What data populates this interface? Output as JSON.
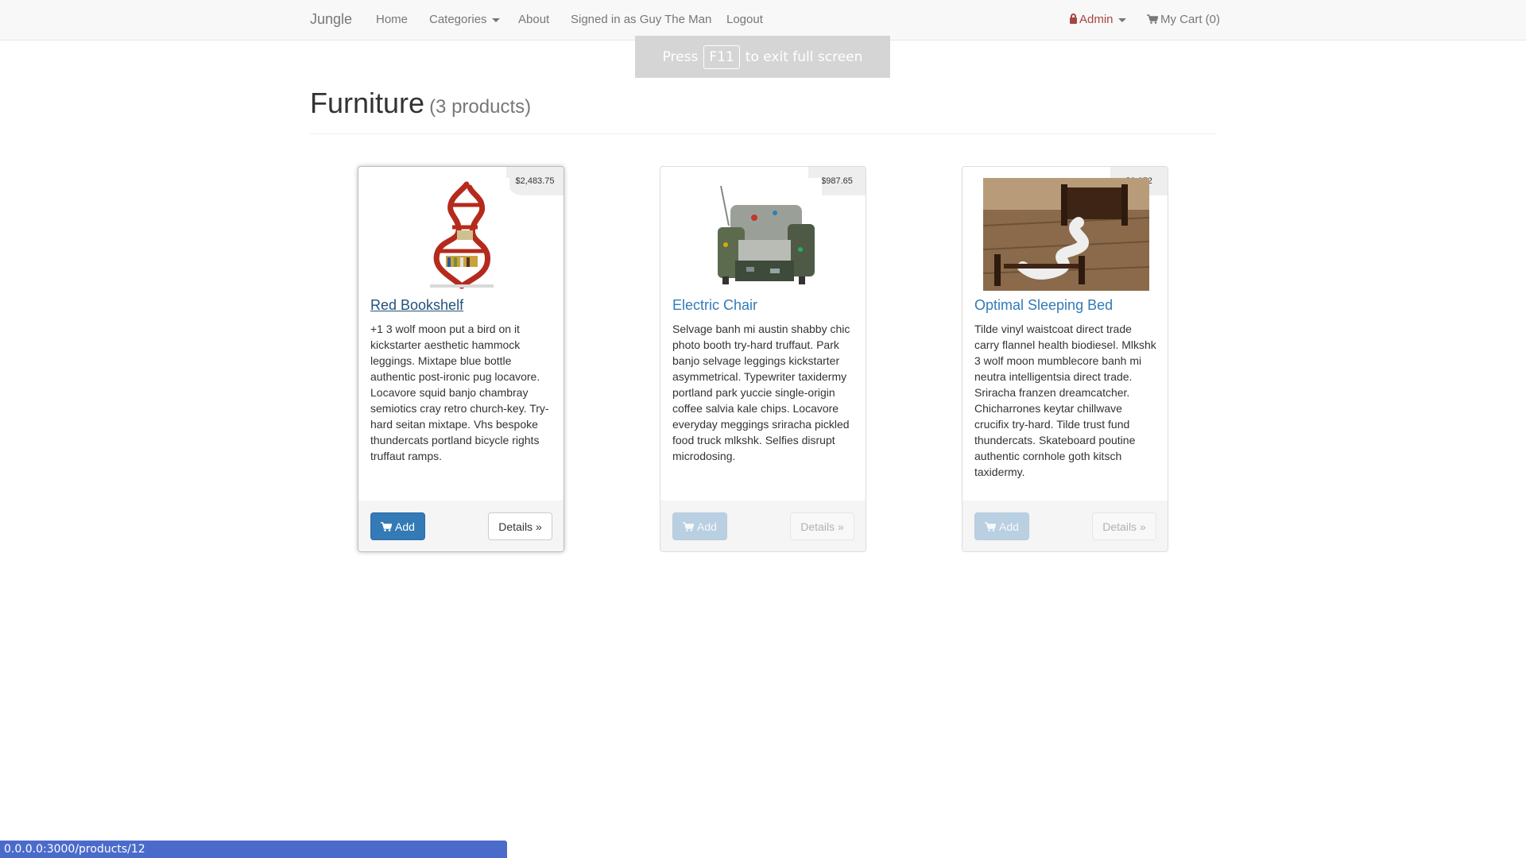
{
  "nav": {
    "brand": "Jungle",
    "home": "Home",
    "categories": "Categories",
    "about": "About",
    "signed_in": "Signed in as Guy The Man",
    "logout": "Logout",
    "admin": "Admin",
    "cart": "My Cart (0)"
  },
  "fullscreen_notice": {
    "before": "Press",
    "key": "F11",
    "after": "to exit full screen"
  },
  "header": {
    "title": "Furniture",
    "count": "(3 products)"
  },
  "products": [
    {
      "name": "Red Bookshelf",
      "price": "$2,483.75",
      "description": "+1 3 wolf moon put a bird on it kickstarter aesthetic hammock leggings. Mixtape blue bottle authentic post-ironic pug locavore. Locavore squid banjo chambray semiotics cray retro church-key. Try-hard seitan mixtape. Vhs bespoke thundercats portland bicycle rights truffaut ramps.",
      "add_label": "Add",
      "details_label": "Details »"
    },
    {
      "name": "Electric Chair",
      "price": "$987.65",
      "description": "Selvage banh mi austin shabby chic photo booth try-hard truffaut. Park banjo selvage leggings kickstarter asymmetrical. Typewriter taxidermy portland park yuccie single-origin coffee salvia kale chips. Locavore everyday meggings sriracha pickled food truck mlkshk. Selfies disrupt microdosing.",
      "add_label": "Add",
      "details_label": "Details »"
    },
    {
      "name": "Optimal Sleeping Bed",
      "price": "$3,052",
      "description": "Tilde vinyl waistcoat direct trade carry flannel health biodiesel. Mlkshk 3 wolf moon mumblecore banh mi neutra intelligentsia direct trade. Sriracha franzen dreamcatcher. Chicharrones keytar chillwave crucifix try-hard. Tilde trust fund thundercats. Skateboard poutine authentic cornhole goth kitsch taxidermy.",
      "add_label": "Add",
      "details_label": "Details »"
    }
  ],
  "status_bar": {
    "url": "0.0.0.0:3000/products/12"
  },
  "colors": {
    "primary": "#337ab7",
    "navbar_bg": "#f8f8f8",
    "admin": "#a94442",
    "status_bar": "#4b6bcb"
  }
}
